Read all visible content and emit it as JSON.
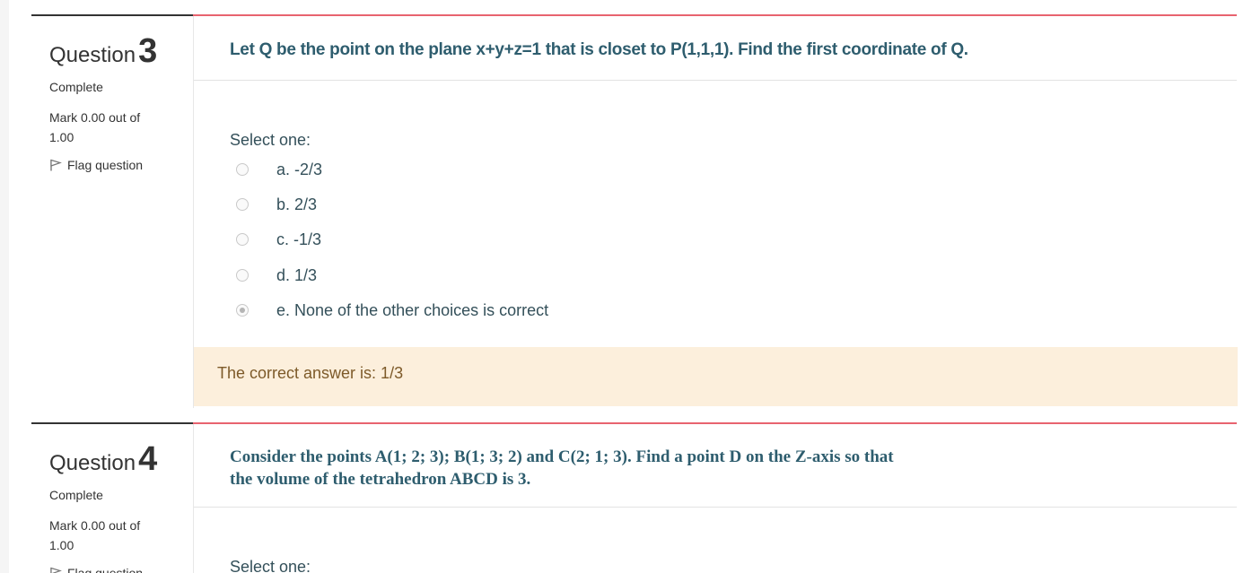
{
  "questions": [
    {
      "word": "Question",
      "number": "3",
      "state": "Complete",
      "grade": "Mark 0.00 out of 1.00",
      "flag_label": "Flag question",
      "text": "Let Q be the point on the plane x+y+z=1 that is closet to P(1,1,1). Find the first coordinate of Q.",
      "prompt": "Select one:",
      "options": [
        {
          "label": "a. -2/3",
          "checked": false
        },
        {
          "label": "b. 2/3",
          "checked": false
        },
        {
          "label": "c. -1/3",
          "checked": false
        },
        {
          "label": "d. 1/3",
          "checked": false
        },
        {
          "label": "e. None of the other choices is correct",
          "checked": true
        }
      ],
      "feedback": "The correct answer is: 1/3"
    },
    {
      "word": "Question",
      "number": "4",
      "state": "Complete",
      "grade": "Mark 0.00 out of 1.00",
      "flag_label": "Flag question",
      "text_line1": "Consider the points A(1; 2; 3); B(1; 3; 2) and C(2; 1; 3). Find a point D on the Z-axis so that",
      "text_line2": "the volume of the tetrahedron ABCD is 3.",
      "prompt": "Select one:"
    }
  ],
  "colors": {
    "accent_border": "#e8636f",
    "question_text": "#2e5d6e",
    "feedback_bg": "#fcefdc",
    "feedback_text": "#7d5a29"
  },
  "icons": {
    "flag": "flag-icon",
    "radio": "radio-icon"
  }
}
